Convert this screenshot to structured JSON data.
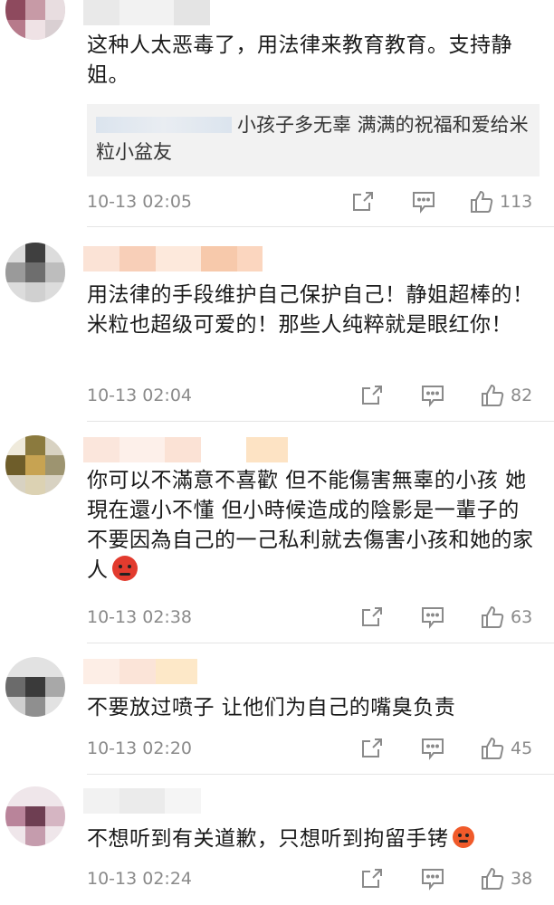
{
  "comments": [
    {
      "text": "这种人太恶毒了，用法律来教育教育。支持静姐。",
      "quote": "小孩子多无辜 满满的祝福和爱给米粒小盆友",
      "time": "10-13 02:05",
      "likes": "113"
    },
    {
      "text": "用法律的手段维护自己保护自己！静姐超棒的！米粒也超级可爱的！那些人纯粹就是眼红你！",
      "time": "10-13 02:04",
      "likes": "82"
    },
    {
      "text": "你可以不滿意不喜歡 但不能傷害無辜的小孩 她現在還小不懂 但小時候造成的陰影是一輩子的  不要因為自己的一己私利就去傷害小孩和她的家人",
      "time": "10-13 02:38",
      "likes": "63"
    },
    {
      "text": "不要放过喷子 让他们为自己的嘴臭负责",
      "time": "10-13 02:20",
      "likes": "45"
    },
    {
      "text": "不想听到有关道歉，只想听到拘留手铐",
      "time": "10-13 02:24",
      "likes": "38"
    }
  ],
  "icons": {
    "share": "share-icon",
    "reply": "comment-icon",
    "like": "thumbs-up-icon"
  },
  "colors": {
    "meta_text": "#8a8a8a",
    "body_text": "#1a1a1a",
    "quote_bg": "#f2f2f2",
    "divider": "#e5e5e5"
  }
}
